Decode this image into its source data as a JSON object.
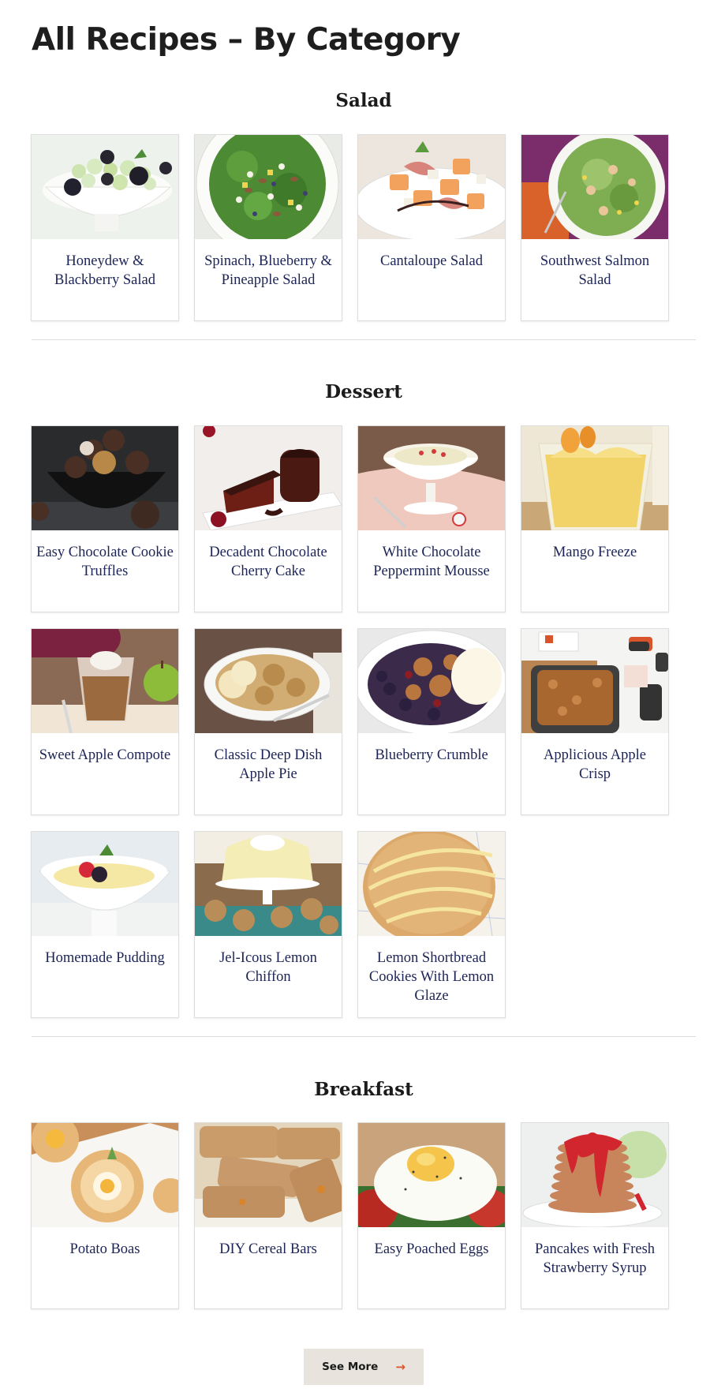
{
  "page": {
    "title": "All Recipes – By Category"
  },
  "sections": [
    {
      "heading": "Salad",
      "recipes": [
        {
          "title": "Honeydew & Blackberry Salad"
        },
        {
          "title": "Spinach, Blueberry & Pineapple Salad"
        },
        {
          "title": "Cantaloupe Salad"
        },
        {
          "title": "Southwest Salmon Salad"
        }
      ]
    },
    {
      "heading": "Dessert",
      "recipes": [
        {
          "title": "Easy Chocolate Cookie Truffles"
        },
        {
          "title": "Decadent Chocolate Cherry Cake"
        },
        {
          "title": "White Chocolate Peppermint Mousse"
        },
        {
          "title": "Mango Freeze"
        },
        {
          "title": "Sweet Apple Compote"
        },
        {
          "title": "Classic Deep Dish Apple Pie"
        },
        {
          "title": "Blueberry Crumble"
        },
        {
          "title": "Applicious Apple Crisp"
        },
        {
          "title": "Homemade Pudding"
        },
        {
          "title": "Jel-Icous Lemon Chiffon"
        },
        {
          "title": "Lemon Shortbread Cookies With Lemon Glaze"
        }
      ]
    },
    {
      "heading": "Breakfast",
      "recipes": [
        {
          "title": "Potato Boas"
        },
        {
          "title": "DIY Cereal Bars"
        },
        {
          "title": "Easy Poached Eggs"
        },
        {
          "title": "Pancakes with Fresh Strawberry Syrup"
        }
      ]
    }
  ],
  "actions": {
    "see_more_label": "See More"
  }
}
